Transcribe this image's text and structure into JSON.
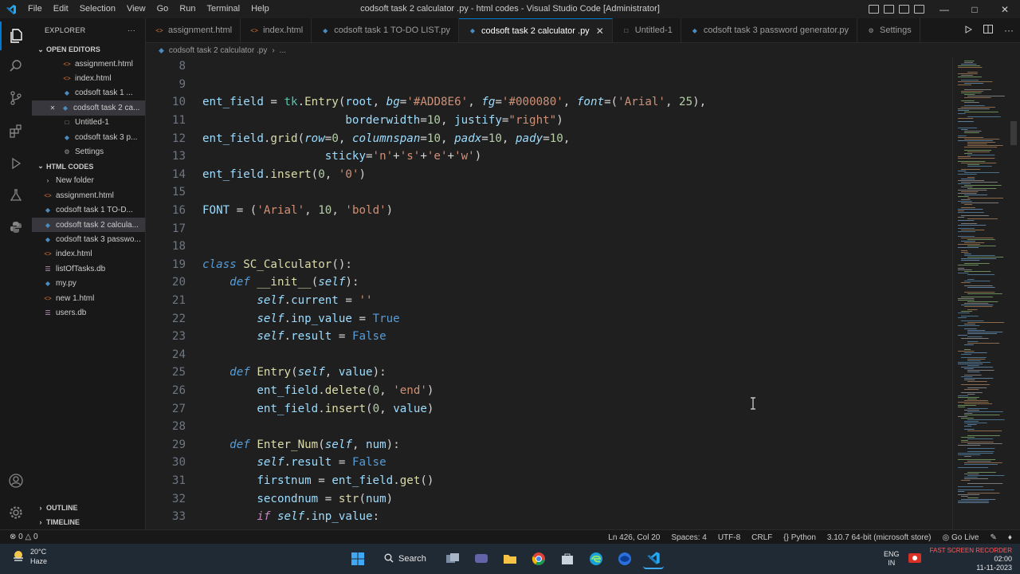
{
  "window": {
    "title": "codsoft task 2 calculator .py - html codes - Visual Studio Code [Administrator]",
    "menu": [
      "File",
      "Edit",
      "Selection",
      "View",
      "Go",
      "Run",
      "Terminal",
      "Help"
    ]
  },
  "explorer": {
    "header": "EXPLORER",
    "open_editors_label": "OPEN EDITORS",
    "open_editors": [
      {
        "name": "assignment.html",
        "icon": "html-icon"
      },
      {
        "name": "index.html",
        "icon": "html-icon"
      },
      {
        "name": "codsoft task 1 ...",
        "icon": "python-icon"
      },
      {
        "name": "codsoft task 2 ca...",
        "icon": "python-icon"
      },
      {
        "name": "Untitled-1",
        "icon": "file-icon"
      },
      {
        "name": "codsoft task 3 p...",
        "icon": "python-icon"
      },
      {
        "name": "Settings",
        "icon": "settings-icon"
      }
    ],
    "folder_label": "HTML CODES",
    "files": [
      {
        "name": "New folder",
        "icon": "folder-icon"
      },
      {
        "name": "assignment.html",
        "icon": "html-icon"
      },
      {
        "name": "codsoft task 1 TO-D...",
        "icon": "python-icon"
      },
      {
        "name": "codsoft task 2 calcula...",
        "icon": "python-icon"
      },
      {
        "name": "codsoft task 3 passwo...",
        "icon": "python-icon"
      },
      {
        "name": "index.html",
        "icon": "html-icon"
      },
      {
        "name": "listOfTasks.db",
        "icon": "database-icon"
      },
      {
        "name": "my.py",
        "icon": "python-icon"
      },
      {
        "name": "new 1.html",
        "icon": "html-icon"
      },
      {
        "name": "users.db",
        "icon": "database-icon"
      }
    ],
    "outline_label": "OUTLINE",
    "timeline_label": "TIMELINE"
  },
  "tabs": [
    {
      "label": "assignment.html",
      "icon": "html-icon"
    },
    {
      "label": "index.html",
      "icon": "html-icon"
    },
    {
      "label": "codsoft task 1 TO-DO LIST.py",
      "icon": "python-icon"
    },
    {
      "label": "codsoft task 2 calculator .py",
      "icon": "python-icon"
    },
    {
      "label": "Untitled-1",
      "icon": "file-icon"
    },
    {
      "label": "codsoft task 3 password generator.py",
      "icon": "python-icon"
    },
    {
      "label": "Settings",
      "icon": "settings-icon"
    }
  ],
  "breadcrumb": {
    "file": "codsoft task 2 calculator .py",
    "rest": "..."
  },
  "code": {
    "line_numbers": [
      "8",
      "9",
      "10",
      "11",
      "12",
      "13",
      "14",
      "15",
      "16",
      "17",
      "18",
      "19",
      "20",
      "21",
      "22",
      "23",
      "24",
      "25",
      "26",
      "27",
      "28",
      "29",
      "30",
      "31",
      "32",
      "33"
    ],
    "lines": [
      "",
      "",
      "ent_field = tk.Entry(root, bg='#ADD8E6', fg='#000080', font=('Arial', 25),",
      "                     borderwidth=10, justify=\"right\")",
      "ent_field.grid(row=0, columnspan=10, padx=10, pady=10,",
      "                  sticky='n'+'s'+'e'+'w')",
      "ent_field.insert(0, '0')",
      "",
      "FONT = ('Arial', 10, 'bold')",
      "",
      "",
      "class SC_Calculator():",
      "    def __init__(self):",
      "        self.current = ''",
      "        self.inp_value = True",
      "        self.result = False",
      "",
      "    def Entry(self, value):",
      "        ent_field.delete(0, 'end')",
      "        ent_field.insert(0, value)",
      "",
      "    def Enter_Num(self, num):",
      "        self.result = False",
      "        firstnum = ent_field.get()",
      "        secondnum = str(num)",
      "        if self.inp_value:"
    ]
  },
  "status": {
    "errors": "0",
    "warnings": "0",
    "position": "Ln 426, Col 20",
    "spaces": "Spaces: 4",
    "encoding": "UTF-8",
    "eol": "CRLF",
    "language": "Python",
    "interpreter": "3.10.7 64-bit (microsoft store)",
    "golive": "Go Live"
  },
  "taskbar": {
    "temperature": "20°C",
    "weather": "Haze",
    "search": "Search",
    "lang_top": "ENG",
    "lang_bottom": "IN",
    "time": "02:00",
    "date": "11-11-2023",
    "recorder": "FAST SCREEN RECORDER"
  },
  "colors": {
    "accent": "#0078d4",
    "editor_bg": "#1f1f1f",
    "keyword": "#569cd6",
    "class": "#4ec9b0",
    "function": "#dcdcaa",
    "string": "#ce9178",
    "number": "#b5cea8"
  }
}
